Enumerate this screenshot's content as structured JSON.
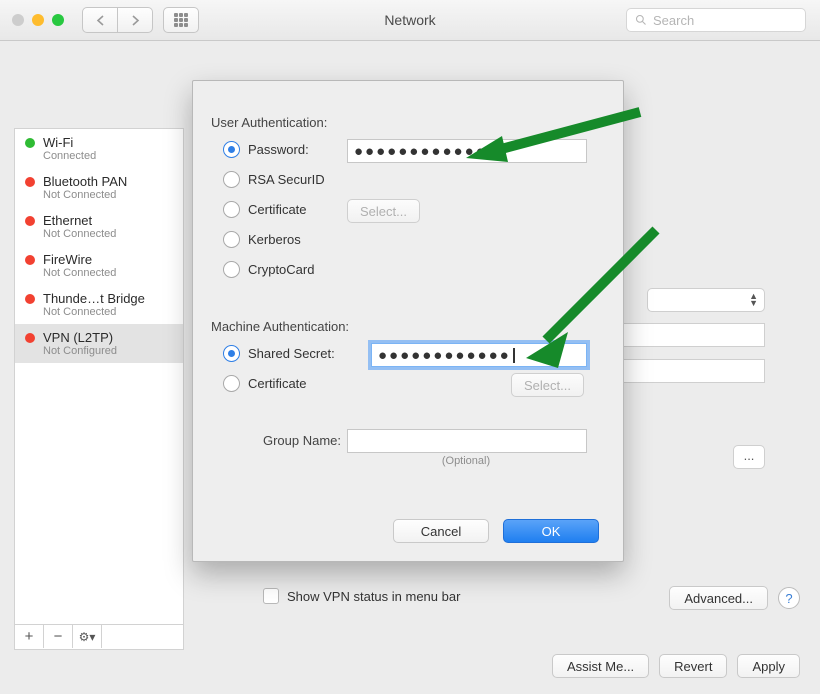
{
  "titlebar": {
    "title": "Network",
    "search_placeholder": "Search"
  },
  "sidebar": {
    "items": [
      {
        "name": "Wi-Fi",
        "status": "Connected",
        "color": "green"
      },
      {
        "name": "Bluetooth PAN",
        "status": "Not Connected",
        "color": "red"
      },
      {
        "name": "Ethernet",
        "status": "Not Connected",
        "color": "red"
      },
      {
        "name": "FireWire",
        "status": "Not Connected",
        "color": "red"
      },
      {
        "name": "Thunde…t Bridge",
        "status": "Not Connected",
        "color": "red"
      },
      {
        "name": "VPN (L2TP)",
        "status": "Not Configured",
        "color": "red"
      }
    ],
    "footer": {
      "add": "+",
      "remove": "−",
      "gear": "⚙▾"
    }
  },
  "main": {
    "show_vpn_status": "Show VPN status in menu bar",
    "advanced": "Advanced...",
    "overflow": "..."
  },
  "sheet": {
    "user_auth_label": "User Authentication:",
    "user_auth": {
      "password": "Password:",
      "password_value": "●●●●●●●●●●●●",
      "rsa": "RSA SecurID",
      "cert": "Certificate",
      "cert_select": "Select...",
      "kerberos": "Kerberos",
      "crypto": "CryptoCard"
    },
    "machine_auth_label": "Machine Authentication:",
    "machine_auth": {
      "shared": "Shared Secret:",
      "shared_value": "●●●●●●●●●●●●",
      "cert": "Certificate",
      "cert_select": "Select..."
    },
    "group_name_label": "Group Name:",
    "group_name_value": "",
    "group_name_hint": "(Optional)",
    "cancel": "Cancel",
    "ok": "OK"
  },
  "bottom": {
    "assist": "Assist Me...",
    "revert": "Revert",
    "apply": "Apply"
  }
}
